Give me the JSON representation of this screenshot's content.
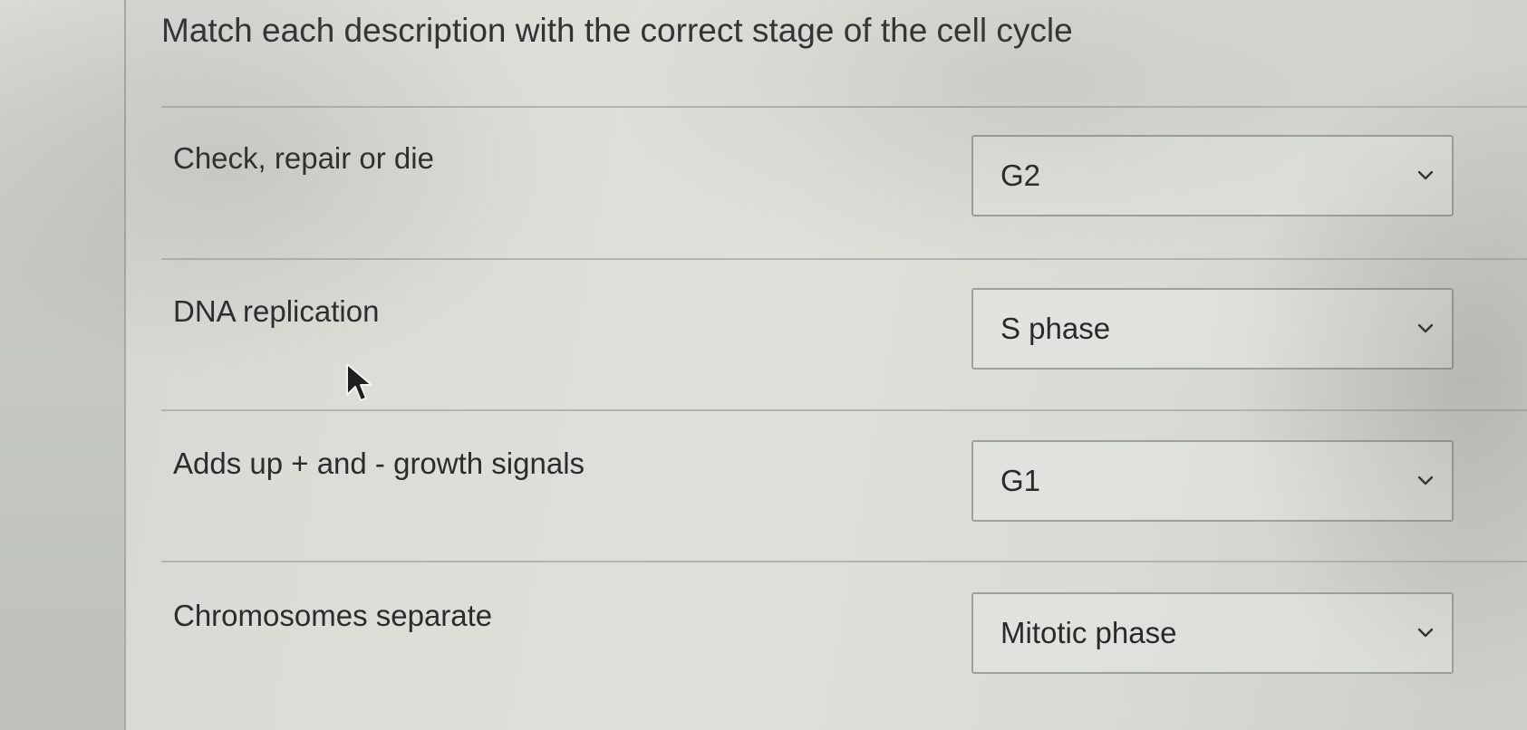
{
  "question": {
    "title": "Match each description with the correct stage of the cell cycle"
  },
  "rows": [
    {
      "description": "Check, repair or die",
      "selected": "G2"
    },
    {
      "description": "DNA replication",
      "selected": "S phase"
    },
    {
      "description": "Adds up + and - growth signals",
      "selected": "G1"
    },
    {
      "description": "Chromosomes separate",
      "selected": "Mitotic phase"
    }
  ],
  "icons": {
    "dropdown": "chevron-down-icon",
    "pointer": "mouse-cursor-icon"
  },
  "colors": {
    "background": "#dcdcd7",
    "divider": "#b3b4af",
    "select_border": "#9fa09b",
    "text": "#2c2c2c"
  }
}
